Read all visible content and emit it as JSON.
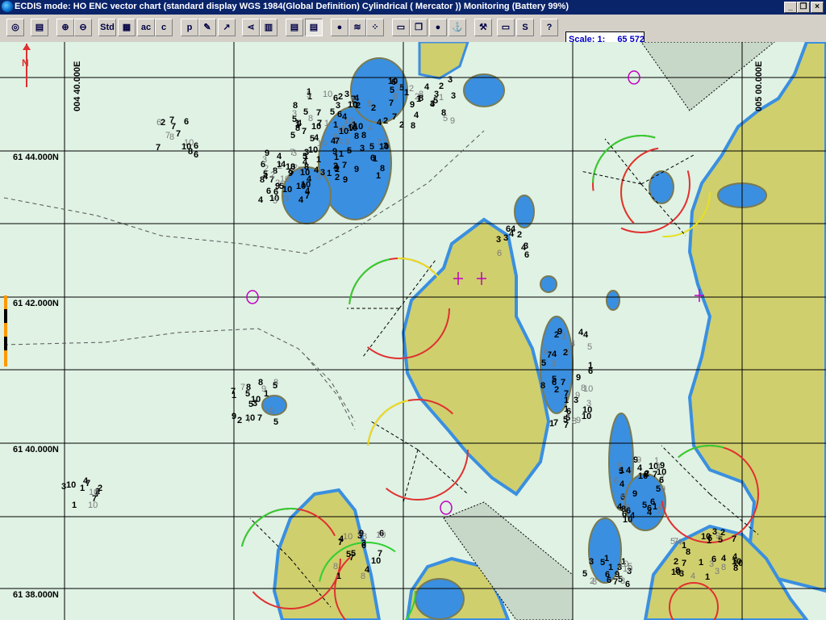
{
  "window": {
    "title": "ECDIS mode: HO ENC vector chart (standard display  WGS 1984(Global Definition)  Cylindrical ( Mercator )) Monitoring  (Battery  99%)",
    "min_btn": "_",
    "restore_btn": "❐",
    "close_btn": "×"
  },
  "toolbar": {
    "buttons": [
      {
        "name": "ring-buoy-icon",
        "glyph": "◎"
      },
      {
        "name": "chart-book-icon",
        "glyph": "▤"
      },
      {
        "name": "zoom-in-icon",
        "glyph": "⊕"
      },
      {
        "name": "zoom-out-icon",
        "glyph": "⊖"
      },
      {
        "name": "standard-display-icon",
        "glyph": "Std"
      },
      {
        "name": "layers-icon",
        "glyph": "▦"
      },
      {
        "name": "text-labels-icon",
        "glyph": "ac"
      },
      {
        "name": "contour-c-icon",
        "glyph": "c"
      },
      {
        "name": "pencil-p-icon",
        "glyph": "p"
      },
      {
        "name": "draw-pencil-icon",
        "glyph": "✎"
      },
      {
        "name": "draw-line-icon",
        "glyph": "↗"
      },
      {
        "name": "share-nodes-icon",
        "glyph": "⋖"
      },
      {
        "name": "table-grid-icon",
        "glyph": "▥"
      },
      {
        "name": "open-book-icon",
        "glyph": "▤"
      },
      {
        "name": "open-book-active-icon",
        "glyph": "▤"
      },
      {
        "name": "dot-point-icon",
        "glyph": "●"
      },
      {
        "name": "tides-icon",
        "glyph": "≋"
      },
      {
        "name": "fit-view-icon",
        "glyph": "⁘"
      },
      {
        "name": "folder-open-icon",
        "glyph": "▭"
      },
      {
        "name": "pages-icon",
        "glyph": "❒"
      },
      {
        "name": "traffic-light-icon",
        "glyph": "●"
      },
      {
        "name": "anchor-icon",
        "glyph": "⚓"
      },
      {
        "name": "hammer-icon",
        "glyph": "⚒"
      },
      {
        "name": "printer-icon",
        "glyph": "▭"
      },
      {
        "name": "s-curve-icon",
        "glyph": "S"
      },
      {
        "name": "help-icon",
        "glyph": "?"
      }
    ],
    "scale_label": "Scale: 1:",
    "scale_value": "65 572"
  },
  "chart": {
    "lat_labels": [
      "61 44.000N",
      "61 42.000N",
      "61 40.000N",
      "61 38.000N"
    ],
    "lon_labels": [
      "004 40.000E",
      "005 00.000E"
    ],
    "north_label": "N",
    "colors": {
      "sea": "#dff2e4",
      "shallow": "#3a8fe0",
      "land": "#cfcf6e",
      "grid": "#000000",
      "sector_red": "#e03030",
      "sector_green": "#30d030",
      "sector_yellow": "#e8e020",
      "magenta": "#c000c0"
    }
  }
}
